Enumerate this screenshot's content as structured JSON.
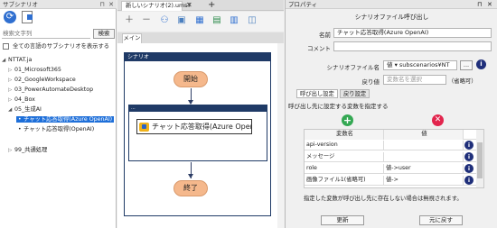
{
  "left_panel": {
    "title": "サブシナリオ",
    "pin": "⊓",
    "close": "✕",
    "search": {
      "placeholder": "検索文字列",
      "button_label": "検索"
    },
    "show_all_label": "全ての言語のサブシナリオを表示する",
    "tree": {
      "root": "NTTAT.ja",
      "folders": [
        "01_Microsoft365",
        "02_GoogleWorkspace",
        "03_PowerAutomateDesktop",
        "04_Box",
        "05_生成AI"
      ],
      "children": [
        "チャット応答取得(Azure OpenAI)",
        "チャット応答取得(OpenAI)"
      ],
      "last_folder": "99_共通処理"
    }
  },
  "editor": {
    "tab_label": "新しいシナリオ(2).ums7",
    "tab_close": "✕",
    "tab_add": "+",
    "main_tab": "メイン",
    "scenario_label": "シナリオ",
    "start_label": "開始",
    "end_label": "終了",
    "group_label": "...",
    "action_label": "チャット応答取得(Azure OpenA..."
  },
  "properties": {
    "title": "プロパティ",
    "pin": "⊓",
    "close": "✕",
    "section": "シナリオファイル呼び出し",
    "name_label": "名前",
    "name_value": "チャット応答取得(Azure OpenAI)",
    "comment_label": "コメント",
    "comment_value": "",
    "file_label": "シナリオファイル名",
    "file_mode": "値",
    "file_value": "subscenarios¥NT",
    "file_button": "...",
    "return_label": "戻り値",
    "return_placeholder": "変数名を選択",
    "return_optional": "（省略可）",
    "tab_call": "呼び出し設定",
    "tab_return": "戻り設定",
    "help_text": "呼び出し先に設定する変数を指定する",
    "grid_headers": [
      "変数名",
      "値"
    ],
    "grid_rows": [
      {
        "name": "api-version",
        "value": ""
      },
      {
        "name": "メッセージ",
        "value": ""
      },
      {
        "name": "role",
        "value": "値->user"
      },
      {
        "name": "画像ファイル1(省略可)",
        "value": "値->"
      }
    ],
    "note": "指定した変数が呼び出し先に存在しない場合は無視されます。",
    "update_button": "更新",
    "restore_button": "元に戻す"
  }
}
